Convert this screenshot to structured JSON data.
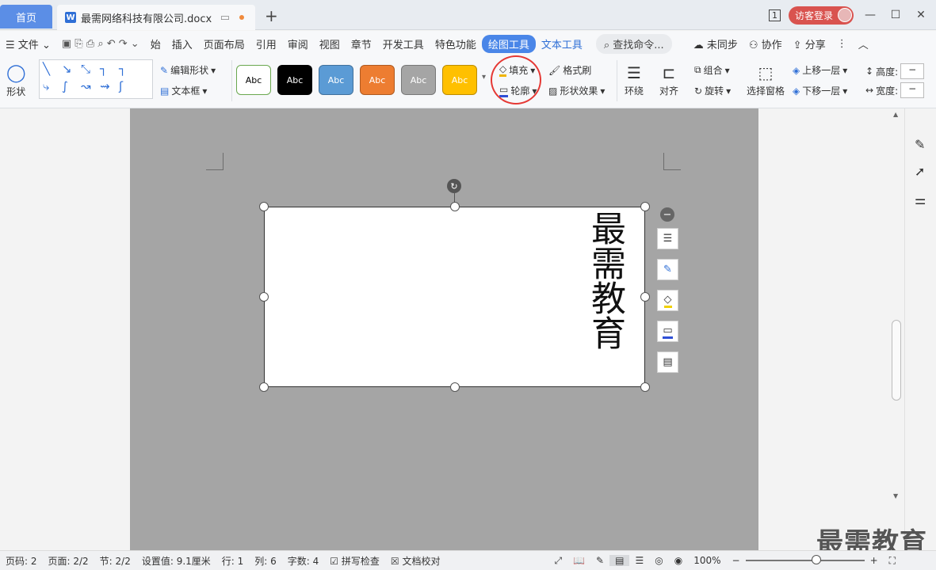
{
  "title_bar": {
    "home_tab": "首页",
    "doc_tab": "最需网络科技有限公司.docx",
    "badge": "1",
    "login": "访客登录"
  },
  "menu": {
    "file": "文件",
    "items": [
      "始",
      "插入",
      "页面布局",
      "引用",
      "审阅",
      "视图",
      "章节",
      "开发工具",
      "特色功能"
    ],
    "active_tab": "绘图工具",
    "text_tool": "文本工具",
    "search": "查找命令...",
    "right": [
      "未同步",
      "协作",
      "分享"
    ]
  },
  "ribbon": {
    "shape": "形状",
    "edit_shape": "编辑形状",
    "text_box": "文本框",
    "styles": [
      "Abc",
      "Abc",
      "Abc",
      "Abc",
      "Abc",
      "Abc"
    ],
    "style_colors": {
      "s1_border": "#6aa84f",
      "s2": "#000000",
      "s3": "#5b9bd5",
      "s4": "#ed7d31",
      "s5": "#a5a5a5",
      "s6": "#ffc000"
    },
    "fill": "填充",
    "outline": "轮廓",
    "format_painter": "格式刷",
    "shape_effect": "形状效果",
    "wrap": "环绕",
    "align": "对齐",
    "group": "组合",
    "rotate": "旋转",
    "select_pane": "选择窗格",
    "bring_forward": "上移一层",
    "send_backward": "下移一层",
    "height": "高度:",
    "width": "宽度:"
  },
  "document": {
    "textbox_text": "最需教育"
  },
  "status": {
    "page_num": "页码: 2",
    "pages": "页面: 2/2",
    "section": "节: 2/2",
    "setting": "设置值: 9.1厘米",
    "row": "行: 1",
    "col": "列: 6",
    "words": "字数: 4",
    "spell": "拼写检查",
    "proof": "文档校对",
    "zoom": "100%"
  },
  "watermark": "最需教育"
}
